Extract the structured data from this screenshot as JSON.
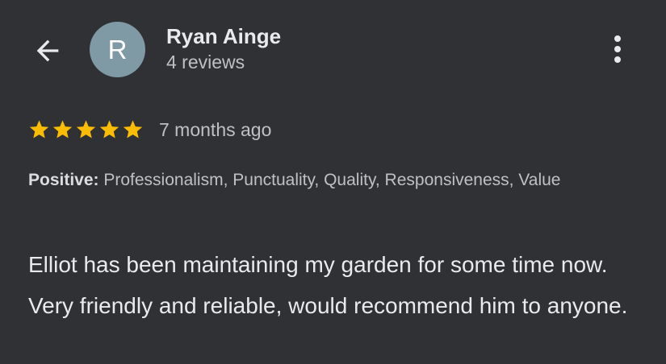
{
  "header": {
    "back_icon": "arrow-left-icon",
    "avatar_letter": "R",
    "avatar_color": "#7f9aa5",
    "reviewer_name": "Ryan Ainge",
    "review_count": "4 reviews",
    "more_icon": "more-vert-icon"
  },
  "review": {
    "rating": 5,
    "rating_max": 5,
    "star_icon": "star-icon",
    "star_color": "#fbbc04",
    "date": "7 months ago",
    "attributes_label": "Positive:",
    "attributes_value": " Professionalism, Punctuality, Quality, Responsiveness, Value",
    "text": "Elliot has been maintaining my garden for some time now. Very friendly and reliable, would recommend him to anyone."
  }
}
